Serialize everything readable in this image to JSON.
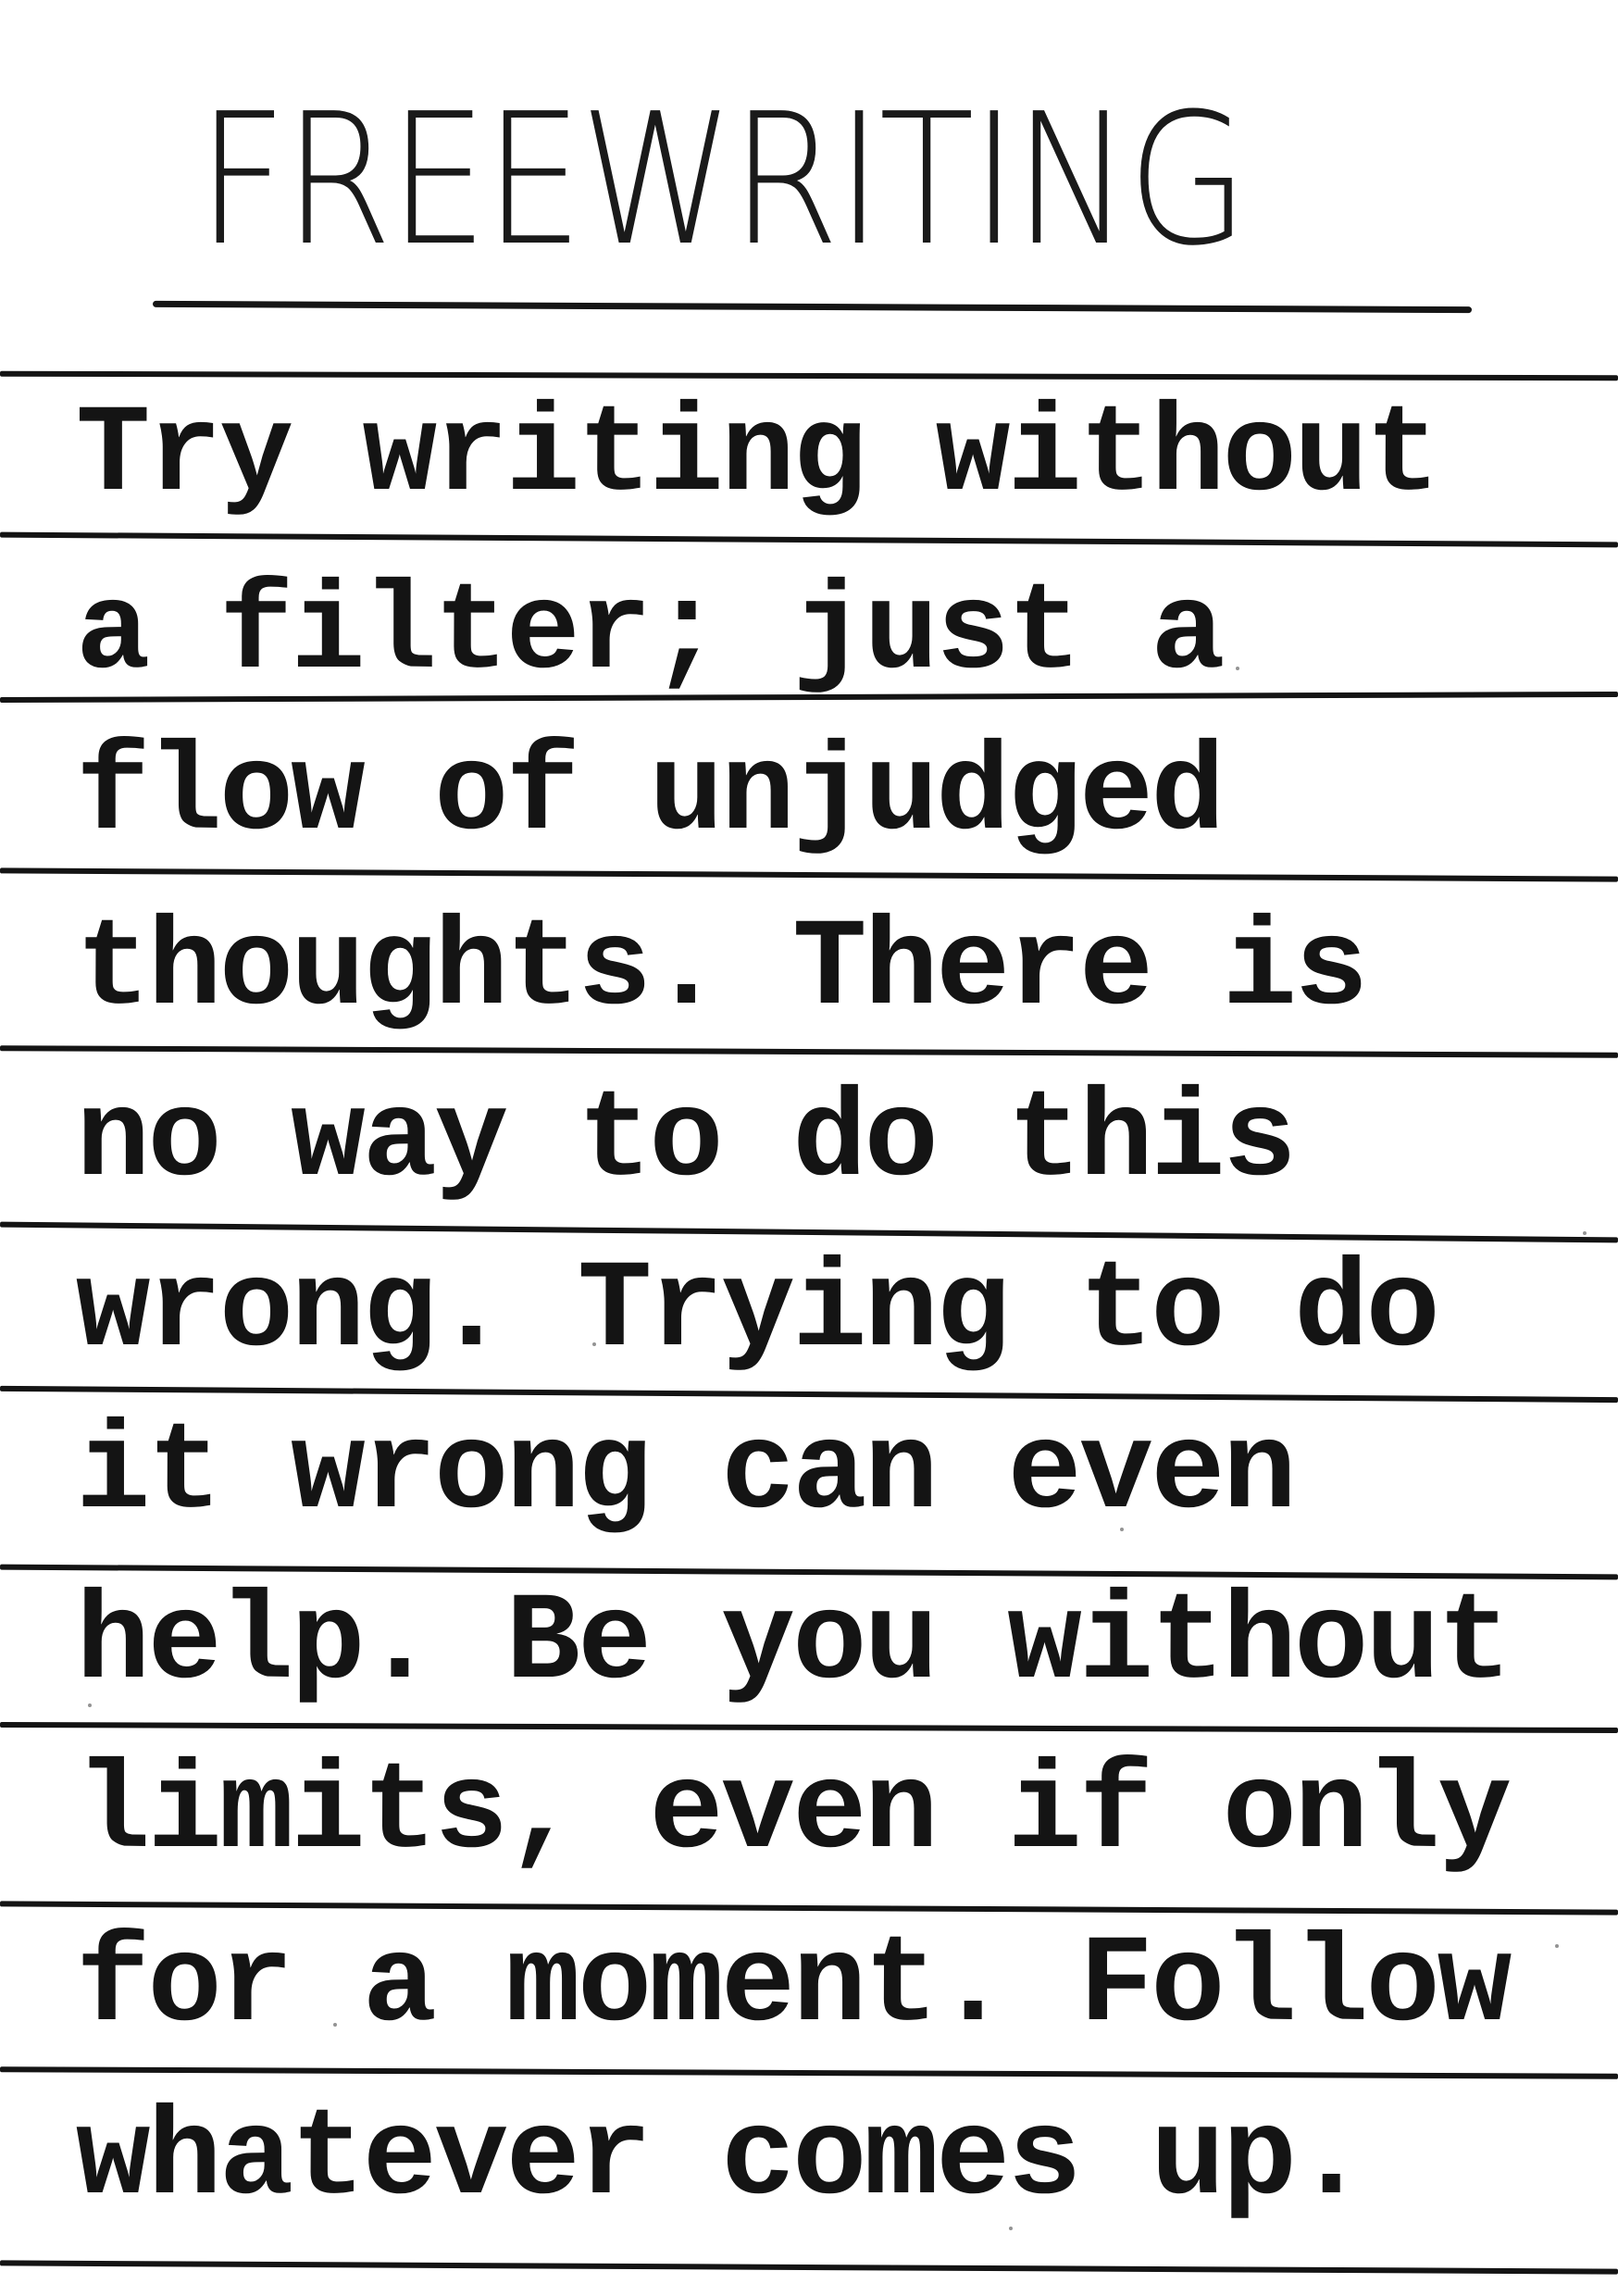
{
  "document": {
    "title": "FREEWRITING",
    "lines": [
      "Try writing without",
      "a filter; just a",
      "flow of unjudged",
      "thoughts. There is",
      "no way to do this",
      "wrong. Trying to do",
      "it wrong can even",
      "help. Be you without",
      "limits, even if only",
      "for a moment. Follow",
      "whatever comes up."
    ]
  },
  "colors": {
    "ink": "#141414",
    "paper": "#ffffff"
  }
}
